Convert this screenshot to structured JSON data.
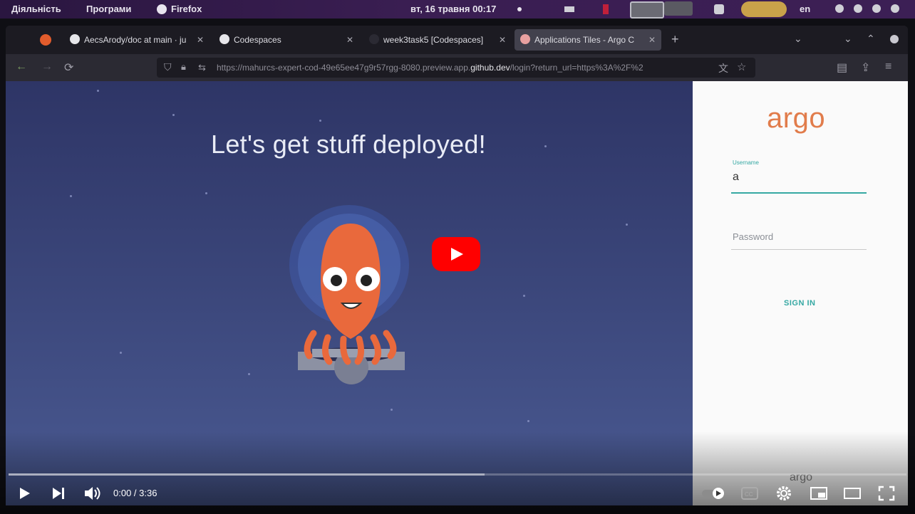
{
  "top_bar": {
    "activities": "Діяльність",
    "programs": "Програми",
    "app": "Firefox",
    "clock": "вт, 16 травня  00:17",
    "lang": "en"
  },
  "tabs": [
    {
      "label": "AecsArody/doc at main · ju",
      "icon": "github-icon"
    },
    {
      "label": "Codespaces",
      "icon": "github-icon"
    },
    {
      "label": "week3task5 [Codespaces]",
      "icon": "codespaces-icon"
    },
    {
      "label": "Applications Tiles - Argo C",
      "icon": "argo-icon",
      "active": true
    }
  ],
  "url": {
    "prefix": "https://mahurcs-expert-cod-49e65ee47g9r57rgg-8080.preview.app.",
    "domain": "github.dev",
    "suffix": "/login?return_url=https%3A%2F%2"
  },
  "hero": {
    "headline": "Let's get stuff deployed!"
  },
  "login": {
    "brand": "argo",
    "username_label": "Username",
    "username_value": "a",
    "password_placeholder": "Password",
    "signin": "SIGN IN",
    "footer_brand": "argo"
  },
  "player": {
    "time": "0:00 / 3:36",
    "buffered_fraction": 0.53
  },
  "colors": {
    "youtube_red": "#ff0000",
    "argo_orange": "#e17c4b",
    "signin_teal": "#35a8a3"
  }
}
